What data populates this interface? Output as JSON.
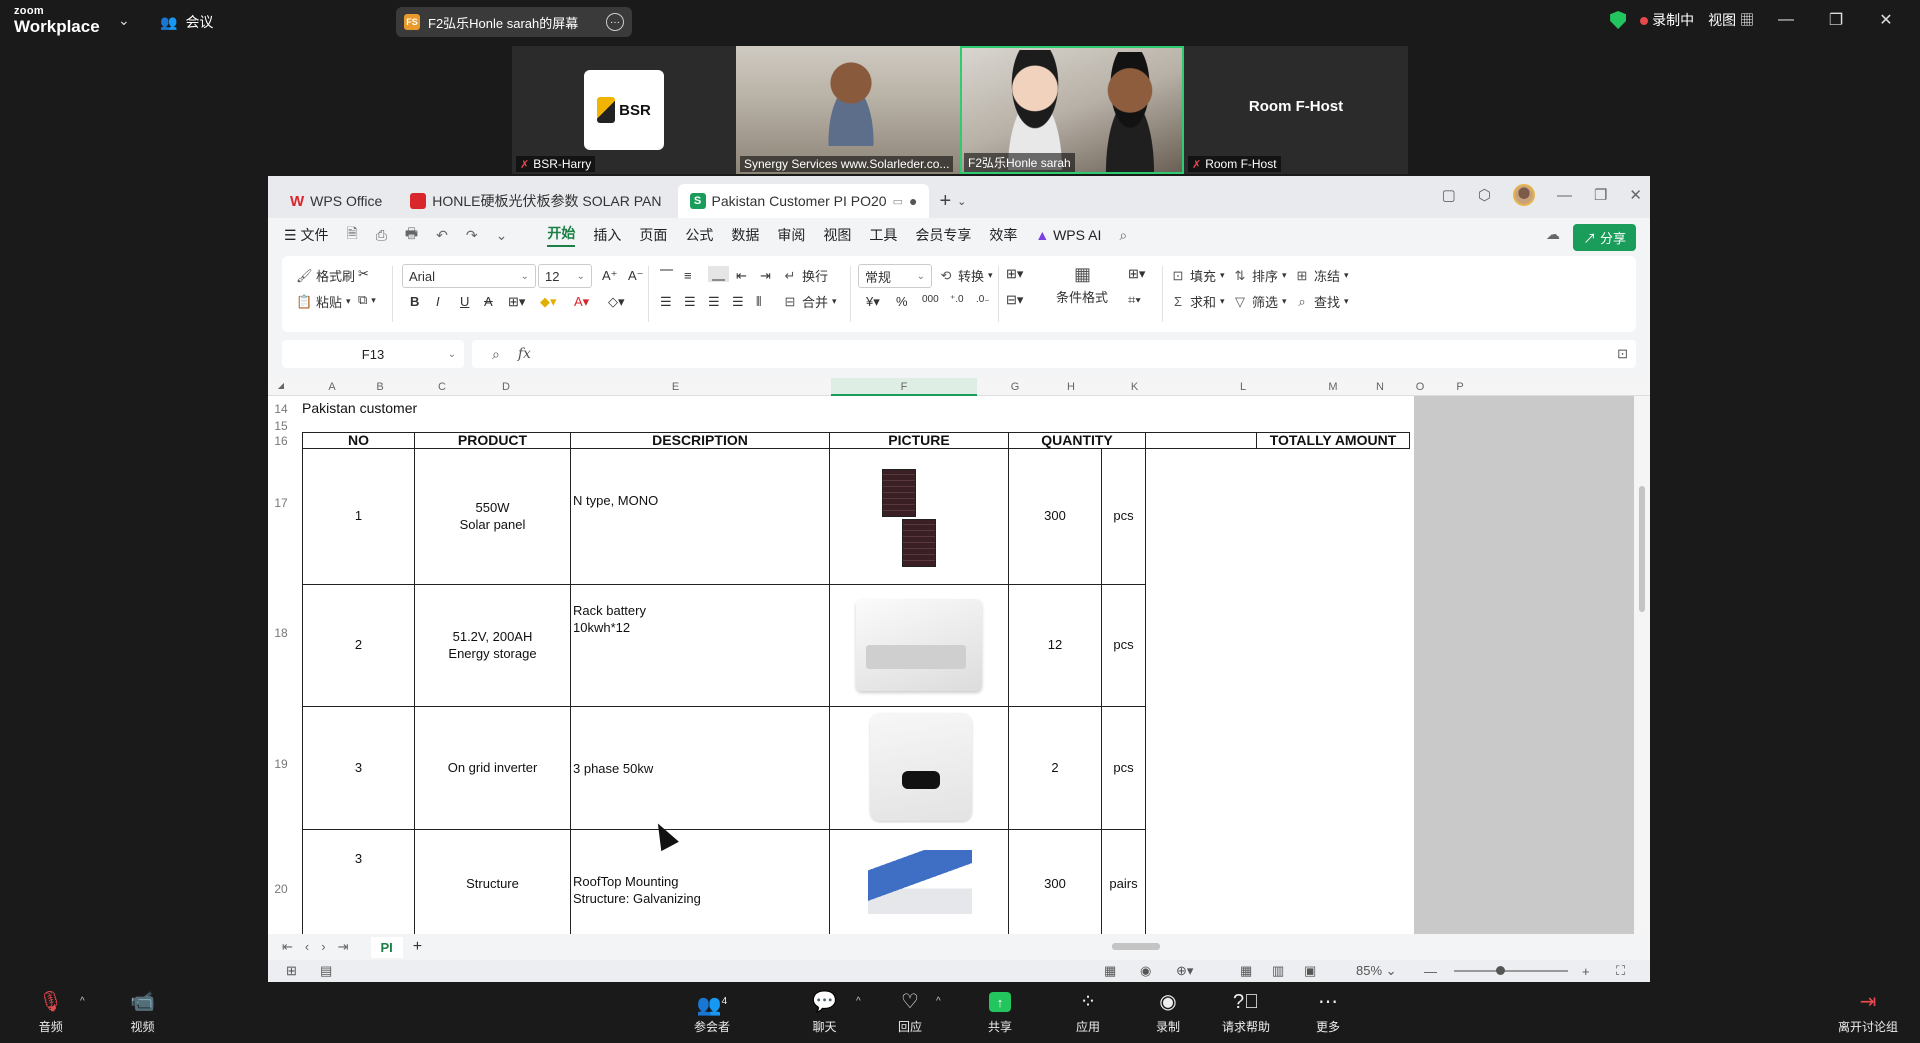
{
  "zoom": {
    "logo_top": "zoom",
    "logo_bottom": "Workplace",
    "meeting_label": "会议",
    "share_pill_icon": "FS",
    "share_pill_text": "F2弘乐Honle sarah的屏幕",
    "recording_label": "录制中",
    "view_label": "视图",
    "tiles": [
      {
        "name": "BSR-Harry",
        "logo_text": "BSR"
      },
      {
        "name": "Synergy Services www.Solarleder.co..."
      },
      {
        "name": "F2弘乐Honle sarah"
      },
      {
        "name": "Room F-Host",
        "title": "Room F-Host"
      }
    ],
    "toolbar": {
      "audio": "音频",
      "video": "视频",
      "participants": "参会者",
      "participant_count": "4",
      "chat": "聊天",
      "react": "回应",
      "share": "共享",
      "apps": "应用",
      "record": "录制",
      "help": "请求帮助",
      "more": "更多",
      "leave": "离开讨论组"
    }
  },
  "wps": {
    "tabs": [
      {
        "label": "WPS Office"
      },
      {
        "label": "HONLE硬板光伏板参数 SOLAR PAN"
      },
      {
        "label": "Pakistan Customer PI PO20"
      }
    ],
    "menu": [
      "文件",
      "开始",
      "插入",
      "页面",
      "公式",
      "数据",
      "审阅",
      "视图",
      "工具",
      "会员专享",
      "效率",
      "WPS AI"
    ],
    "share_button": "分享",
    "ribbon": {
      "format_painter": "格式刷",
      "paste": "粘贴",
      "font": "Arial",
      "font_size": "12",
      "wrap": "换行",
      "merge": "合并",
      "number_format": "常规",
      "convert": "转换",
      "cond_format": "条件格式",
      "fill": "填充",
      "sort": "排序",
      "freeze": "冻结",
      "sum": "求和",
      "filter": "筛选",
      "find": "查找"
    },
    "name_box": "F13",
    "columns": [
      "A",
      "B",
      "C",
      "D",
      "E",
      "F",
      "G",
      "H",
      "K",
      "L",
      "M",
      "N",
      "O",
      "P"
    ],
    "rows": [
      "14",
      "15",
      "16",
      "17",
      "18",
      "19",
      "20"
    ],
    "sheet_title": "Pakistan customer",
    "headers": {
      "no": "NO",
      "product": "PRODUCT",
      "description": "DESCRIPTION",
      "picture": "PICTURE",
      "quantity": "QUANTITY",
      "total": "TOTALLY AMOUNT"
    },
    "items": [
      {
        "no": "1",
        "product_l1": "550W",
        "product_l2": "Solar panel",
        "desc_l1": "N type, MONO",
        "desc_l2": "",
        "qty": "300",
        "unit": "pcs",
        "picture": "solar-panel"
      },
      {
        "no": "2",
        "product_l1": "51.2V, 200AH",
        "product_l2": "Energy storage",
        "desc_l1": "Rack battery",
        "desc_l2": "10kwh*12",
        "qty": "12",
        "unit": "pcs",
        "picture": "battery"
      },
      {
        "no": "3",
        "product_l1": "On grid inverter",
        "product_l2": "",
        "desc_l1": "3 phase 50kw",
        "desc_l2": "",
        "qty": "2",
        "unit": "pcs",
        "picture": "inverter"
      },
      {
        "no": "3",
        "product_l1": "Structure",
        "product_l2": "",
        "desc_l1": "RoofTop Mounting",
        "desc_l2": "Structure: Galvanizing",
        "qty": "300",
        "unit": "pairs",
        "picture": "mounting-structure"
      }
    ],
    "sheet_tab": "PI",
    "zoom_level": "85%"
  }
}
